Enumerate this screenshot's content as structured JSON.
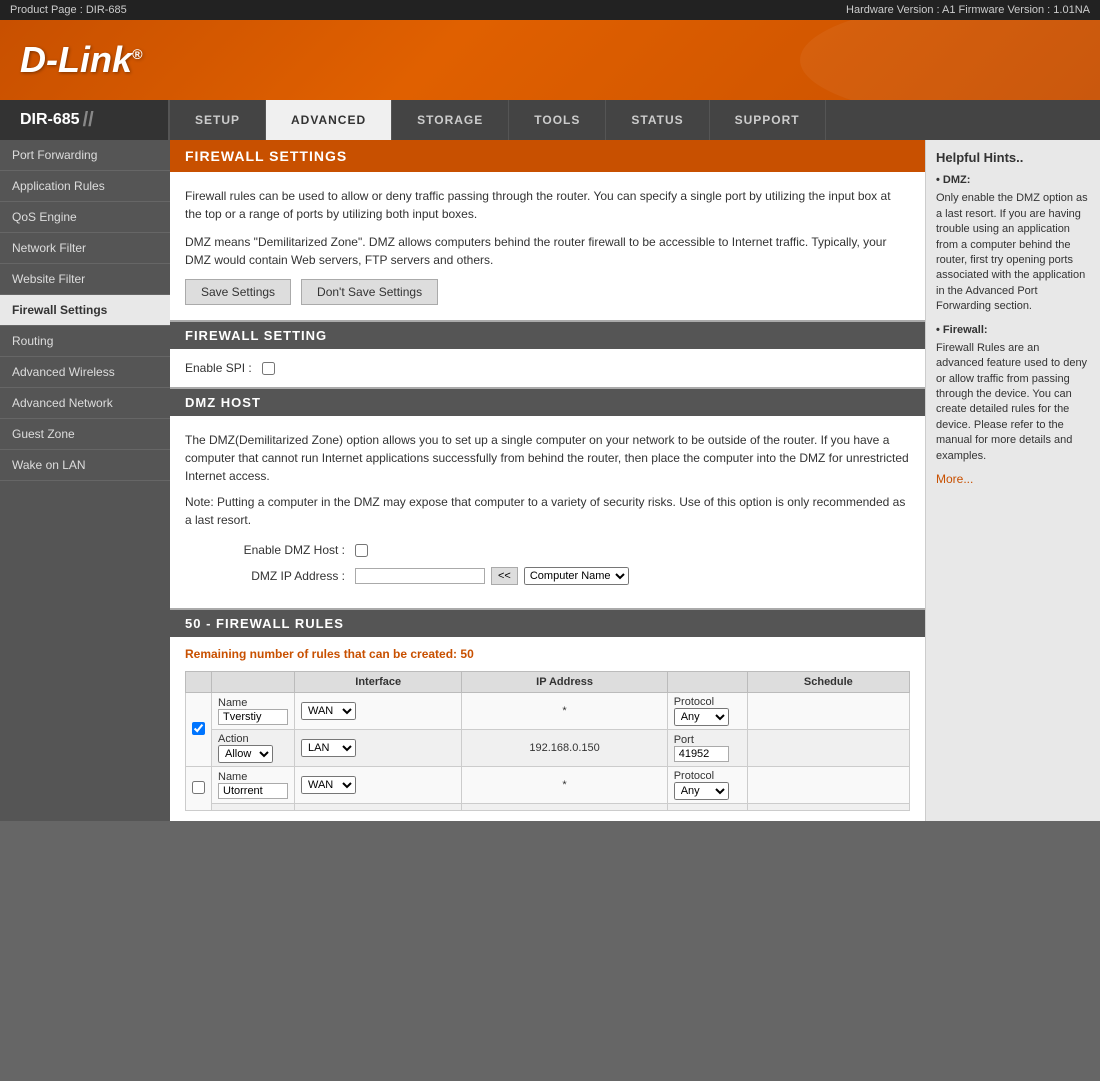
{
  "topbar": {
    "left": "Product Page : DIR-685",
    "right": "Hardware Version : A1     Firmware Version : 1.01NA"
  },
  "logo": "D-Link",
  "logo_sup": "®",
  "nav": {
    "brand": "DIR-685",
    "slashes": "//",
    "tabs": [
      {
        "label": "SETUP",
        "active": false
      },
      {
        "label": "ADVANCED",
        "active": true
      },
      {
        "label": "STORAGE",
        "active": false
      },
      {
        "label": "TOOLS",
        "active": false
      },
      {
        "label": "STATUS",
        "active": false
      },
      {
        "label": "SUPPORT",
        "active": false
      }
    ]
  },
  "sidebar": {
    "items": [
      {
        "label": "Port Forwarding",
        "active": false
      },
      {
        "label": "Application Rules",
        "active": false
      },
      {
        "label": "QoS Engine",
        "active": false
      },
      {
        "label": "Network Filter",
        "active": false
      },
      {
        "label": "Website Filter",
        "active": false
      },
      {
        "label": "Firewall Settings",
        "active": true
      },
      {
        "label": "Routing",
        "active": false
      },
      {
        "label": "Advanced Wireless",
        "active": false
      },
      {
        "label": "Advanced Network",
        "active": false
      },
      {
        "label": "Guest Zone",
        "active": false
      },
      {
        "label": "Wake on LAN",
        "active": false
      }
    ]
  },
  "firewall_settings": {
    "title": "FIREWALL SETTINGS",
    "para1": "Firewall rules can be used to allow or deny traffic passing through the router. You can specify a single port by utilizing the input box at the top or a range of ports by utilizing both input boxes.",
    "para2": "DMZ means \"Demilitarized Zone\". DMZ allows computers behind the router firewall to be accessible to Internet traffic. Typically, your DMZ would contain Web servers, FTP servers and others.",
    "save_btn": "Save Settings",
    "dont_save_btn": "Don't Save Settings"
  },
  "firewall_setting_section": {
    "title": "FIREWALL SETTING",
    "enable_spi_label": "Enable SPI :"
  },
  "dmz_host": {
    "title": "DMZ HOST",
    "para1": "The DMZ(Demilitarized Zone) option allows you to set up a single computer on your network to be outside of the router. If you have a computer that cannot run Internet applications successfully from behind the router, then place the computer into the DMZ for unrestricted Internet access.",
    "note": "Note: Putting a computer in the DMZ may expose that computer to a variety of security risks. Use of this option is only recommended as a last resort.",
    "enable_dmz_label": "Enable DMZ Host :",
    "dmz_ip_label": "DMZ IP Address :",
    "cc_btn": "<<",
    "computer_name_label": "Computer Name",
    "computer_options": [
      "Computer Name"
    ]
  },
  "firewall_rules": {
    "title": "50 - FIREWALL RULES",
    "remaining_label": "Remaining number of rules that can be created:",
    "remaining_count": "50",
    "columns": {
      "interface": "Interface",
      "ip_address": "IP Address",
      "schedule": "Schedule"
    },
    "rows": [
      {
        "checkbox": true,
        "name_label": "Name",
        "name_value": "Tverstiy",
        "action_label": "Action",
        "action_value": "Allow",
        "interface_wan": "WAN",
        "interface_lan": "LAN",
        "ip_top": "*",
        "ip_bottom": "192.168.0.150",
        "protocol_label": "Protocol",
        "protocol_value": "Any",
        "port_label": "Port",
        "port_value": "41952"
      },
      {
        "checkbox": true,
        "name_label": "Name",
        "name_value": "Utorrent",
        "interface_wan": "WAN",
        "protocol_label": "Protocol",
        "protocol_value": "Any",
        "ip_top": "*"
      }
    ]
  },
  "hints": {
    "title": "Helpful Hints..",
    "hints": [
      {
        "label": "DMZ:",
        "text": "Only enable the DMZ option as a last resort. If you are having trouble using an application from a computer behind the router, first try opening ports associated with the application in the Advanced Port Forwarding section."
      },
      {
        "label": "Firewall:",
        "text": "Firewall Rules are an advanced feature used to deny or allow traffic from passing through the device. You can create detailed rules for the device. Please refer to the manual for more details and examples."
      }
    ],
    "more_link": "More..."
  }
}
